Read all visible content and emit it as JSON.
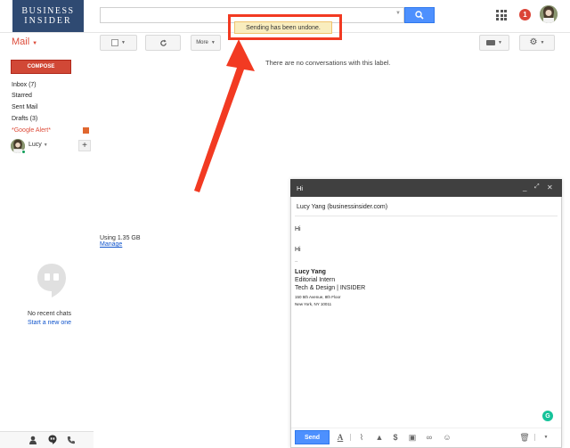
{
  "brand": {
    "line1": "BUSINESS",
    "line2": "INSIDER"
  },
  "search": {
    "value": "",
    "placeholder": ""
  },
  "notifications": {
    "count": "1"
  },
  "header": {
    "mail_label": "Mail",
    "more_label": "More"
  },
  "toast": {
    "message": "Sending has been undone."
  },
  "main": {
    "empty_message": "There are no conversations with this label."
  },
  "sidebar": {
    "compose_label": "COMPOSE",
    "items": [
      {
        "label": "Inbox (7)"
      },
      {
        "label": "Starred"
      },
      {
        "label": "Sent Mail"
      },
      {
        "label": "Drafts (3)"
      },
      {
        "label": "*Google Alert*"
      }
    ],
    "user_name": "Lucy"
  },
  "storage": {
    "usage": "Using 1.35 GB",
    "manage_label": "Manage"
  },
  "chat": {
    "empty_text": "No recent chats",
    "start_link": "Start a new one"
  },
  "compose_window": {
    "title": "Hi",
    "to": "Lucy Yang (businessinsider.com)",
    "subject_line": "Hi",
    "body_greeting": "Hi",
    "signature_sep": "--",
    "sig_name": "Lucy Yang",
    "sig_title": "Editorial Intern",
    "sig_org": "Tech & Design | INSIDER",
    "sig_addr1": "150 5th Avenue, 8th Floor",
    "sig_addr2": "New York, NY 10011",
    "send_label": "Send",
    "grammarly_label": "G"
  },
  "colors": {
    "brand_navy": "#2f4a72",
    "compose_red": "#d14836",
    "send_blue": "#4d90fe",
    "highlight_red": "#f23a22",
    "toast_bg": "#f9edbe"
  },
  "icons": [
    "search-icon",
    "apps-grid-icon",
    "refresh-icon",
    "checkbox-icon",
    "keyboard-icon",
    "gear-icon",
    "hangouts-icon",
    "person-icon",
    "phone-icon",
    "minimize-icon",
    "expand-icon",
    "close-icon",
    "format-text-icon",
    "attach-icon",
    "drive-icon",
    "money-icon",
    "photo-icon",
    "link-icon",
    "emoji-icon",
    "trash-icon",
    "more-options-icon",
    "grammarly-icon"
  ]
}
